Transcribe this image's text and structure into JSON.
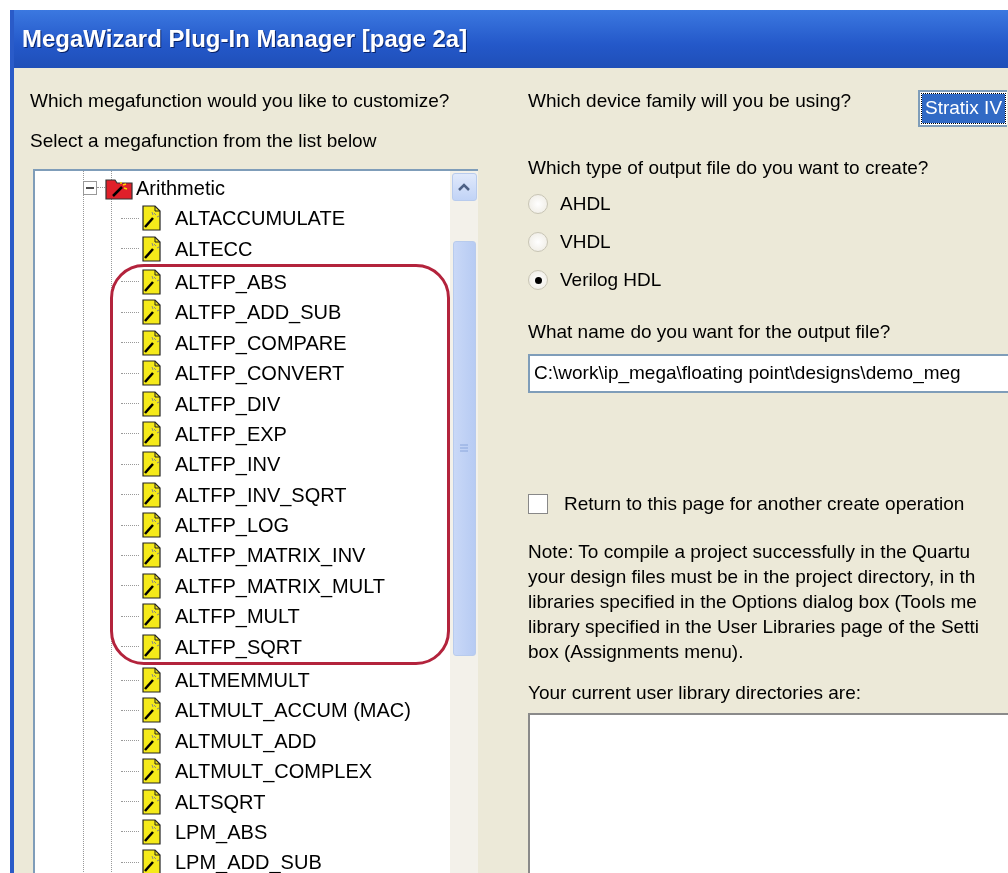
{
  "window": {
    "title": "MegaWizard Plug-In Manager [page 2a]"
  },
  "left": {
    "question": "Which megafunction would you like to customize?",
    "instruction": "Select a megafunction from the list below"
  },
  "tree": [
    {
      "label": "Arithmetic",
      "expanded": true,
      "children": [
        {
          "kind": "item",
          "label": "ALTACCUMULATE"
        },
        {
          "kind": "item",
          "label": "ALTECC"
        },
        {
          "kind": "circled_group",
          "children": [
            {
              "kind": "item",
              "label": "ALTFP_ABS"
            },
            {
              "kind": "item",
              "label": "ALTFP_ADD_SUB"
            },
            {
              "kind": "item",
              "label": "ALTFP_COMPARE"
            },
            {
              "kind": "item",
              "label": "ALTFP_CONVERT"
            },
            {
              "kind": "item",
              "label": "ALTFP_DIV"
            },
            {
              "kind": "item",
              "label": "ALTFP_EXP"
            },
            {
              "kind": "item",
              "label": "ALTFP_INV"
            },
            {
              "kind": "item",
              "label": "ALTFP_INV_SQRT"
            },
            {
              "kind": "item",
              "label": "ALTFP_LOG"
            },
            {
              "kind": "item",
              "label": "ALTFP_MATRIX_INV"
            },
            {
              "kind": "item",
              "label": "ALTFP_MATRIX_MULT"
            },
            {
              "kind": "item",
              "label": "ALTFP_MULT"
            },
            {
              "kind": "item",
              "label": "ALTFP_SQRT"
            }
          ]
        },
        {
          "kind": "item",
          "label": "ALTMEMMULT"
        },
        {
          "kind": "item",
          "label": "ALTMULT_ACCUM (MAC)"
        },
        {
          "kind": "item",
          "label": "ALTMULT_ADD"
        },
        {
          "kind": "item",
          "label": "ALTMULT_COMPLEX"
        },
        {
          "kind": "item",
          "label": "ALTSQRT"
        },
        {
          "kind": "item",
          "label": "LPM_ABS"
        },
        {
          "kind": "item",
          "label": "LPM_ADD_SUB"
        }
      ]
    }
  ],
  "device": {
    "label": "Which device family will you be using?",
    "value": "Stratix IV"
  },
  "output_type": {
    "label": "Which type of output file do you want to create?",
    "options": [
      {
        "label": "AHDL",
        "selected": false
      },
      {
        "label": "VHDL",
        "selected": false
      },
      {
        "label": "Verilog HDL",
        "selected": true
      }
    ]
  },
  "output_name": {
    "label": "What name do you want for the output file?",
    "value": "C:\\work\\ip_mega\\floating point\\designs\\demo_meg"
  },
  "return_option": {
    "label": "Return to this page for another create operation",
    "checked": false
  },
  "note": [
    "Note: To compile a project successfully in the Quartu",
    "your design files must be in the project directory, in th",
    "libraries specified in the Options dialog box (Tools me",
    "library specified in the User Libraries page of the Setti",
    "box (Assignments menu)."
  ],
  "libraries": {
    "label": "Your current user library directories are:"
  }
}
